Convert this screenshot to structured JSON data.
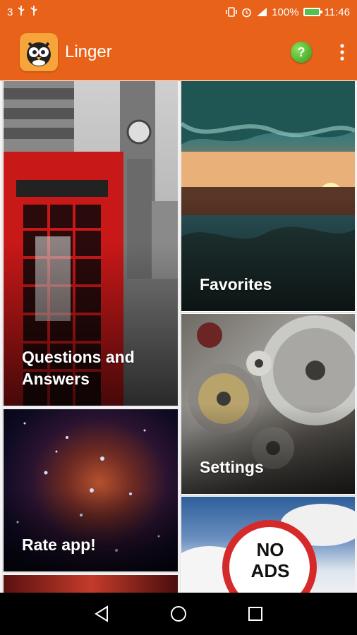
{
  "status": {
    "left_text": "3",
    "battery": "100%",
    "time": "11:46"
  },
  "app": {
    "title": "Linger",
    "help_glyph": "?",
    "menu_glyph": "⋮"
  },
  "tiles": {
    "qa": "Questions and\nAnswers",
    "favorites": "Favorites",
    "settings": "Settings",
    "rate": "Rate app!",
    "ads_sign": "NO\nADS"
  },
  "icons": [
    "usb-icon",
    "usb-icon",
    "vibrate-icon",
    "alarm-icon",
    "signal-icon",
    "battery-icon",
    "help-icon",
    "more-vert-icon",
    "back-icon",
    "home-icon",
    "recents-icon"
  ]
}
